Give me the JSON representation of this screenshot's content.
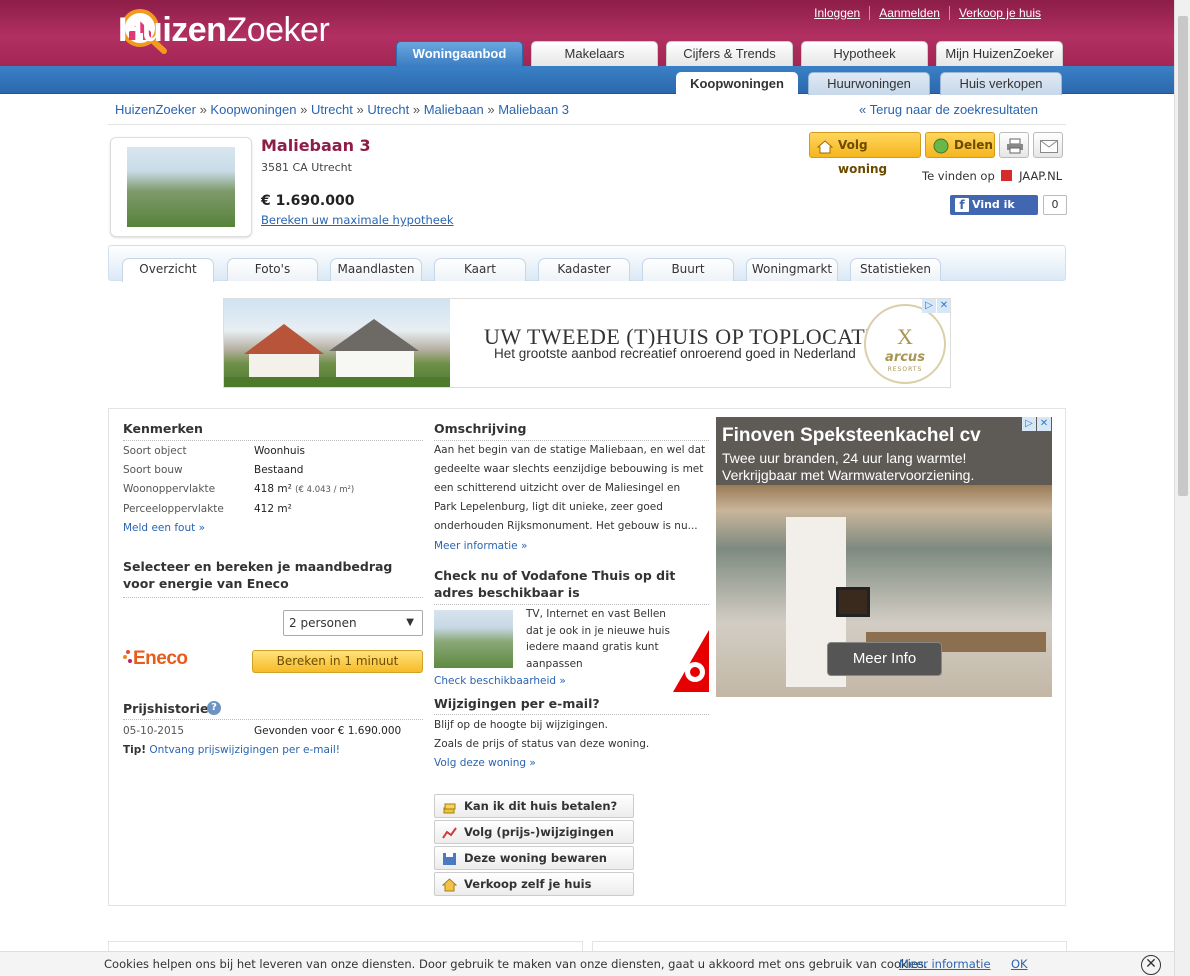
{
  "header": {
    "logo_text_bold": "Huizen",
    "logo_text_light": "Zoeker",
    "top_links": [
      "Inloggen",
      "Aanmelden",
      "Verkoop je huis"
    ],
    "main_tabs": [
      "Woningaanbod",
      "Makelaars",
      "Cijfers & Trends",
      "Hypotheek",
      "Mijn HuizenZoeker"
    ],
    "active_main_tab": "Woningaanbod",
    "sub_tabs": [
      "Koopwoningen",
      "Huurwoningen",
      "Huis verkopen"
    ],
    "active_sub_tab": "Koopwoningen",
    "brand_color": "#a42455",
    "nav_color": "#2f6fb3"
  },
  "breadcrumb": {
    "items": [
      "HuizenZoeker",
      "Koopwoningen",
      "Utrecht",
      "Utrecht",
      "Maliebaan",
      "Maliebaan 3"
    ],
    "separator": "»",
    "back_link": "« Terug naar de zoekresultaten"
  },
  "listing": {
    "title": "Maliebaan 3",
    "address": "3581 CA Utrecht",
    "price": "€ 1.690.000",
    "mortgage_link": "Bereken uw maximale hypotheek",
    "follow_button": "Volg woning",
    "share_button": "Delen",
    "found_on_label": "Te vinden op",
    "found_on_site": "JAAP.NL",
    "fb_like": "Vind ik leuk",
    "fb_count": "0"
  },
  "detail_tabs": [
    "Overzicht",
    "Foto's",
    "Maandlasten",
    "Kaart",
    "Kadaster",
    "Buurt",
    "Woningmarkt",
    "Statistieken"
  ],
  "active_detail_tab": "Overzicht",
  "banner_ad": {
    "headline": "UW TWEEDE (T)HUIS OP TOPLOCATIE",
    "subline": "Het grootste aanbod recreatief onroerend goed in Nederland",
    "brand": "arcus",
    "brand_sub": "RESORTS"
  },
  "kenmerken": {
    "heading": "Kenmerken",
    "rows": [
      {
        "label": "Soort object",
        "value": "Woonhuis"
      },
      {
        "label": "Soort bouw",
        "value": "Bestaand"
      },
      {
        "label": "Woonoppervlakte",
        "value": "418 m²",
        "extra": "(€ 4.043 / m²)"
      },
      {
        "label": "Perceeloppervlakte",
        "value": "412 m²"
      }
    ],
    "report_link": "Meld een fout »"
  },
  "energy": {
    "heading": "Selecteer en bereken je maandbedrag voor energie van Eneco",
    "select_value": "2 personen",
    "brand": "Eneco",
    "button": "Bereken in 1 minuut"
  },
  "price_history": {
    "heading": "Prijshistorie",
    "rows": [
      {
        "date": "05-10-2015",
        "text": "Gevonden voor € 1.690.000"
      }
    ],
    "tip_label": "Tip!",
    "tip_link": "Ontvang prijswijzigingen per e-mail!"
  },
  "description": {
    "heading": "Omschrijving",
    "lines": [
      "Aan het begin van de statige Maliebaan, en wel dat",
      "gedeelte waar slechts eenzijdige bebouwing is met",
      "een schitterend uitzicht over de Maliesingel en",
      "Park Lepelenburg, ligt dit unieke, zeer goed",
      "onderhouden Rijksmonument. Het gebouw is nu..."
    ],
    "more_link": "Meer informatie »"
  },
  "vodafone": {
    "heading": "Check nu of Vodafone Thuis op dit adres beschikbaar is",
    "text_lines": [
      "TV, Internet en vast Bellen",
      "dat je ook in je nieuwe huis",
      "iedere maand gratis kunt",
      "aanpassen"
    ],
    "link": "Check beschikbaarheid »"
  },
  "email_changes": {
    "heading": "Wijzigingen per e-mail?",
    "lines": [
      "Blijf op de hoogte bij wijzigingen.",
      "Zoals de prijs of status van deze woning."
    ],
    "link": "Volg deze woning »"
  },
  "action_buttons": [
    {
      "label": "Kan ik dit huis betalen?",
      "icon": "coins-icon"
    },
    {
      "label": "Volg (prijs-)wijzigingen",
      "icon": "chart-icon"
    },
    {
      "label": "Deze woning bewaren",
      "icon": "save-icon"
    },
    {
      "label": "Verkoop zelf je huis",
      "icon": "home-icon"
    }
  ],
  "side_ad": {
    "title": "Finoven Speksteenkachel cv",
    "line1": "Twee uur branden, 24 uur lang warmte!",
    "line2": "Verkrijgbaar met Warmwatervoorziening.",
    "button": "Meer Info"
  },
  "cookie_bar": {
    "text": "Cookies helpen ons bij het leveren van onze diensten. Door gebruik te maken van onze diensten, gaat u akkoord met ons gebruik van cookies.",
    "more": "Meer informatie",
    "ok": "OK"
  }
}
